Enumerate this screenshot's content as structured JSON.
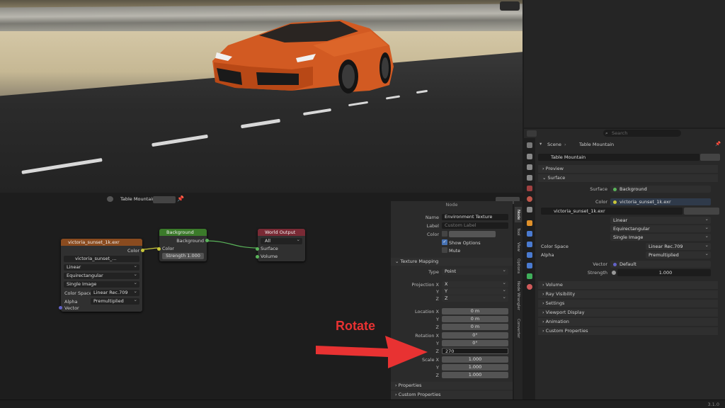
{
  "node_editor": {
    "world_name": "Table Mountain",
    "env_node": {
      "title": "victoria_sunset_1k.exr",
      "out_color": "Color",
      "image_name": "victoria_sunset_...",
      "interp": "Linear",
      "projection": "Equirectangular",
      "extension": "Single Image",
      "color_space_label": "Color Space",
      "color_space": "Linear Rec.709",
      "alpha_label": "Alpha",
      "alpha": "Premultiplied",
      "in_vector": "Vector"
    },
    "bg_node": {
      "title": "Background",
      "out": "Background",
      "in_color": "Color",
      "strength_label": "Strength",
      "strength": "1.000"
    },
    "out_node": {
      "title": "World Output",
      "target": "All",
      "surface": "Surface",
      "volume": "Volume"
    }
  },
  "npanel": {
    "top_label": "Node",
    "name_label": "Name",
    "name": "Environment Texture",
    "label_label": "Label",
    "label_placeholder": "Custom Label",
    "color_label": "Color",
    "show_options": "Show Options",
    "mute": "Mute",
    "tex_mapping": "Texture Mapping",
    "type_label": "Type",
    "type": "Point",
    "projx_label": "Projection X",
    "projx": "X",
    "y": "Y",
    "z": "Z",
    "projy": "Y",
    "projz": "Z",
    "loc_label": "Location X",
    "loc_x": "0 m",
    "loc_y": "0 m",
    "loc_z": "0 m",
    "rot_label": "Rotation X",
    "rot_x": "0°",
    "rot_y": "0°",
    "rot_z": "270",
    "scale_label": "Scale X",
    "scale_x": "1.000",
    "scale_y": "1.000",
    "scale_z": "1.000",
    "properties": "Properties",
    "custom_props": "Custom Properties"
  },
  "vtabs": [
    "Node",
    "Tool",
    "View",
    "Options",
    "Node Wrangler",
    "Converter"
  ],
  "props": {
    "search_placeholder": "Search",
    "breadcrumb_scene": "Scene",
    "breadcrumb_world": "Table Mountain",
    "world_name": "Table Mountain",
    "preview": "Preview",
    "surface_sec": "Surface",
    "surface_label": "Surface",
    "surface_value": "Background",
    "color_label": "Color",
    "color_value": "victoria_sunset_1k.exr",
    "image_name": "victoria_sunset_1k.exr",
    "interp": "Linear",
    "projection": "Equirectangular",
    "extension": "Single Image",
    "color_space_label": "Color Space",
    "color_space": "Linear Rec.709",
    "alpha_label": "Alpha",
    "alpha": "Premultiplied",
    "vector_label": "Vector",
    "vector": "Default",
    "strength_label": "Strength",
    "strength": "1.000",
    "sections": [
      "Volume",
      "Ray Visibility",
      "Settings",
      "Viewport Display",
      "Animation",
      "Custom Properties"
    ]
  },
  "annotation": "Rotate",
  "version": "3.1.0",
  "colors": {
    "accent": "#4772b3",
    "env_node": "#8a4b1f",
    "bg_node": "#3b7a2a",
    "out_node": "#7a2a35",
    "arrow": "#e83232"
  }
}
